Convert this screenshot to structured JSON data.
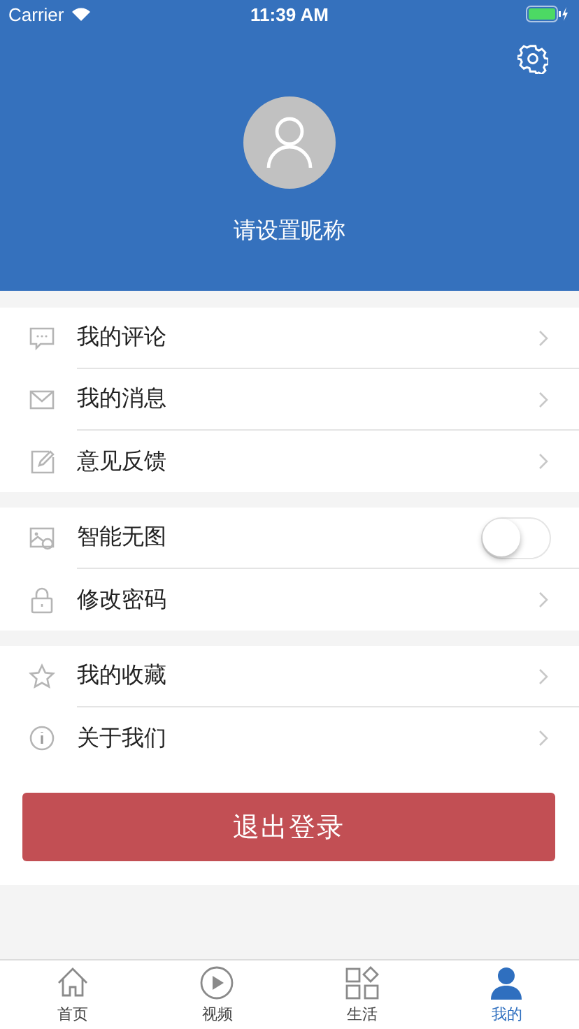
{
  "status_bar": {
    "carrier": "Carrier",
    "time": "11:39 AM"
  },
  "profile": {
    "nickname": "请设置昵称"
  },
  "sections": [
    [
      {
        "label": "我的评论",
        "kind": "link"
      },
      {
        "label": "我的消息",
        "kind": "link"
      },
      {
        "label": "意见反馈",
        "kind": "link"
      }
    ],
    [
      {
        "label": "智能无图",
        "kind": "toggle",
        "on": false
      },
      {
        "label": "修改密码",
        "kind": "link"
      }
    ],
    [
      {
        "label": "我的收藏",
        "kind": "link"
      },
      {
        "label": "关于我们",
        "kind": "link"
      }
    ]
  ],
  "logout_button": "退出登录",
  "tabs": [
    {
      "label": "首页",
      "selected": false
    },
    {
      "label": "视频",
      "selected": false
    },
    {
      "label": "生活",
      "selected": false
    },
    {
      "label": "我的",
      "selected": true
    }
  ]
}
